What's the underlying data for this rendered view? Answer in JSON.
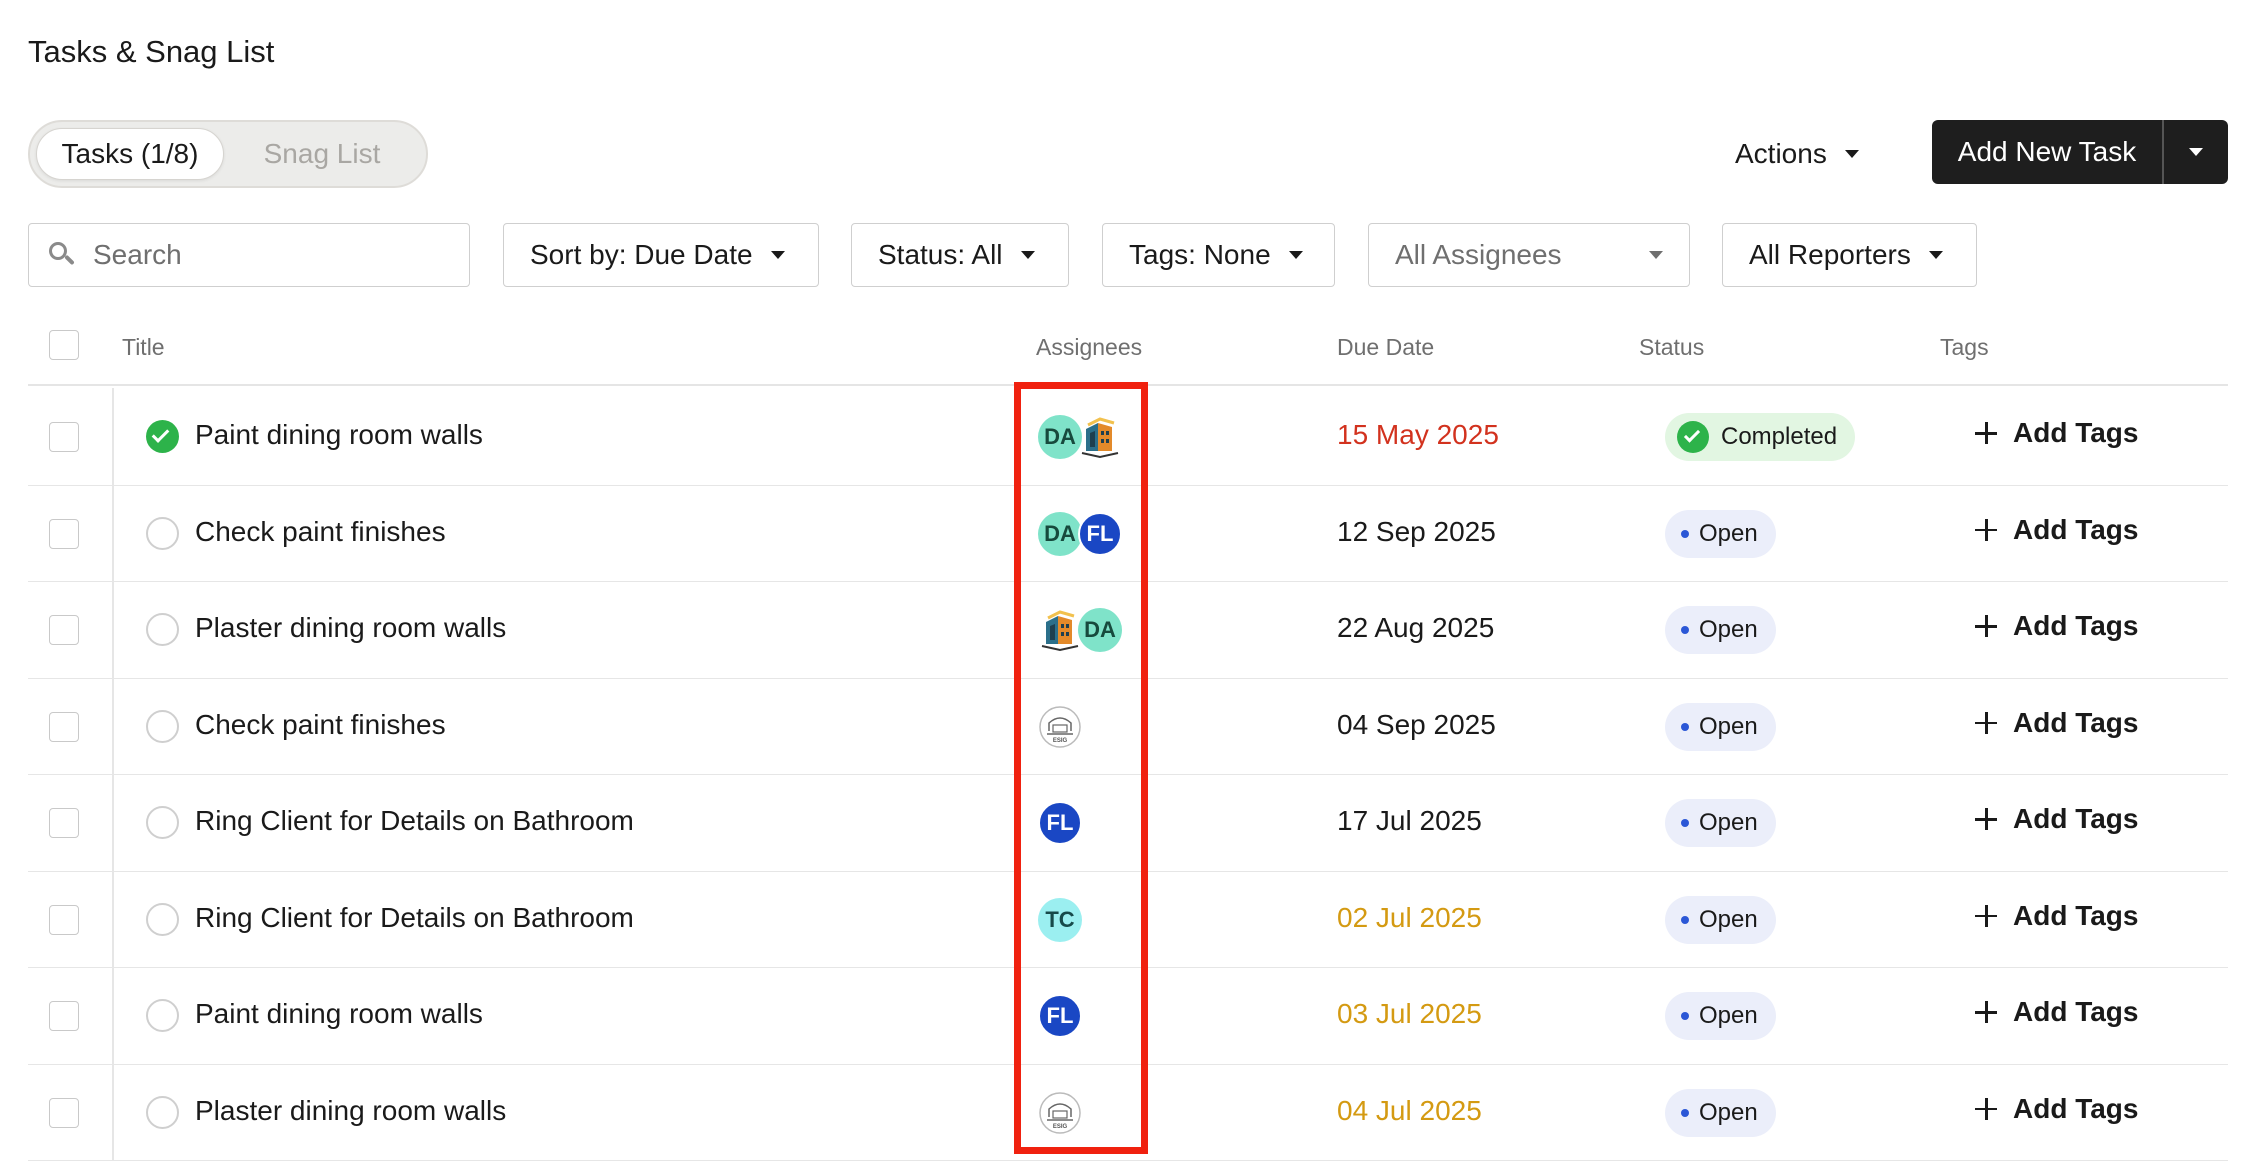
{
  "page": {
    "title": "Tasks & Snag List"
  },
  "tabs": [
    {
      "label": "Tasks (1/8)",
      "active": true
    },
    {
      "label": "Snag List",
      "active": false
    }
  ],
  "toolbar": {
    "actions_label": "Actions",
    "add_task_label": "Add New Task"
  },
  "filters": {
    "search_placeholder": "Search",
    "sort": "Sort by: Due Date",
    "status": "Status: All",
    "tags": "Tags: None",
    "assignees": "All Assignees",
    "reporters": "All Reporters"
  },
  "table": {
    "columns": {
      "title": "Title",
      "assignees": "Assignees",
      "due_date": "Due Date",
      "status": "Status",
      "tags": "Tags"
    },
    "add_tags_label": "Add Tags",
    "rows": [
      {
        "title": "Paint dining room walls",
        "done": true,
        "assignees": [
          "DA",
          "building-logo"
        ],
        "due": "15 May 2025",
        "due_state": "overdue",
        "status": "Completed"
      },
      {
        "title": "Check paint finishes",
        "done": false,
        "assignees": [
          "DA",
          "FL"
        ],
        "due": "12 Sep 2025",
        "due_state": "normal",
        "status": "Open"
      },
      {
        "title": "Plaster dining room walls",
        "done": false,
        "assignees": [
          "building-logo",
          "DA"
        ],
        "due": "22 Aug 2025",
        "due_state": "normal",
        "status": "Open"
      },
      {
        "title": "Check paint finishes",
        "done": false,
        "assignees": [
          "esig-logo"
        ],
        "due": "04 Sep 2025",
        "due_state": "normal",
        "status": "Open"
      },
      {
        "title": "Ring Client for Details on Bathroom",
        "done": false,
        "assignees": [
          "FL"
        ],
        "due": "17 Jul 2025",
        "due_state": "normal",
        "status": "Open"
      },
      {
        "title": "Ring Client for Details on Bathroom",
        "done": false,
        "assignees": [
          "TC"
        ],
        "due": "02 Jul 2025",
        "due_state": "soon",
        "status": "Open"
      },
      {
        "title": "Paint dining room walls",
        "done": false,
        "assignees": [
          "FL"
        ],
        "due": "03 Jul 2025",
        "due_state": "soon",
        "status": "Open"
      },
      {
        "title": "Plaster dining room walls",
        "done": false,
        "assignees": [
          "esig-logo"
        ],
        "due": "04 Jul 2025",
        "due_state": "soon",
        "status": "Open"
      }
    ]
  },
  "colors": {
    "overdue": "#d2321e",
    "due_soon": "#d49a12",
    "completed": "#2db34a",
    "open_dot": "#2b57d6",
    "highlight": "#f0210f"
  },
  "icons": {
    "search": "search-icon",
    "check": "check-circle-icon",
    "plus": "plus-icon",
    "caret": "caret-down-icon",
    "building_logo": "building-logo-avatar",
    "esig_logo": "esig-logo-avatar"
  }
}
